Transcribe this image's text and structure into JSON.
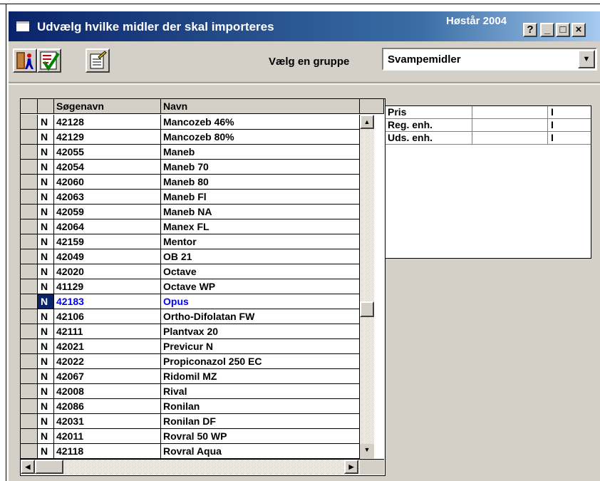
{
  "window": {
    "title": "Udvælg hvilke midler der skal importeres",
    "season": "Høstår 2004",
    "help_label": "?",
    "minimize_label": "_",
    "maximize_label": "□",
    "close_label": "×"
  },
  "toolbar": {
    "buttons": [
      "exit-icon",
      "checklist-icon",
      "edit-list-icon"
    ]
  },
  "group": {
    "label": "Vælg en gruppe",
    "selected": "Svampemidler"
  },
  "grid": {
    "headers": [
      "",
      "",
      "Søgenavn",
      "Navn"
    ],
    "rows": [
      {
        "flag": "N",
        "code": "42128",
        "name": "Mancozeb 46%"
      },
      {
        "flag": "N",
        "code": "42129",
        "name": "Mancozeb 80%"
      },
      {
        "flag": "N",
        "code": "42055",
        "name": "Maneb"
      },
      {
        "flag": "N",
        "code": "42054",
        "name": "Maneb 70"
      },
      {
        "flag": "N",
        "code": "42060",
        "name": "Maneb 80"
      },
      {
        "flag": "N",
        "code": "42063",
        "name": "Maneb Fl"
      },
      {
        "flag": "N",
        "code": "42059",
        "name": "Maneb NA"
      },
      {
        "flag": "N",
        "code": "42064",
        "name": "Manex FL"
      },
      {
        "flag": "N",
        "code": "42159",
        "name": "Mentor"
      },
      {
        "flag": "N",
        "code": "42049",
        "name": "OB 21"
      },
      {
        "flag": "N",
        "code": "42020",
        "name": "Octave"
      },
      {
        "flag": "N",
        "code": "41129",
        "name": "Octave WP"
      },
      {
        "flag": "N",
        "code": "42183",
        "name": "Opus",
        "selected": true
      },
      {
        "flag": "N",
        "code": "42106",
        "name": "Ortho-Difolatan FW"
      },
      {
        "flag": "N",
        "code": "42111",
        "name": "Plantvax 20"
      },
      {
        "flag": "N",
        "code": "42021",
        "name": "Previcur N"
      },
      {
        "flag": "N",
        "code": "42022",
        "name": "Propiconazol 250 EC"
      },
      {
        "flag": "N",
        "code": "42067",
        "name": "Ridomil MZ"
      },
      {
        "flag": "N",
        "code": "42008",
        "name": "Rival"
      },
      {
        "flag": "N",
        "code": "42086",
        "name": "Ronilan"
      },
      {
        "flag": "N",
        "code": "42031",
        "name": "Ronilan DF"
      },
      {
        "flag": "N",
        "code": "42011",
        "name": "Rovral 50 WP"
      },
      {
        "flag": "N",
        "code": "42118",
        "name": "Rovral Aqua"
      }
    ]
  },
  "info": {
    "rows": [
      {
        "label": "Pris",
        "value": "",
        "unit": "I"
      },
      {
        "label": "Reg. enh.",
        "value": "",
        "unit": "I"
      },
      {
        "label": "Uds. enh.",
        "value": "",
        "unit": "I"
      }
    ]
  },
  "colors": {
    "titlebar_start": "#0a246a",
    "titlebar_end": "#a6caf0",
    "selected_text": "#0000ff",
    "face": "#d4d0c8"
  }
}
